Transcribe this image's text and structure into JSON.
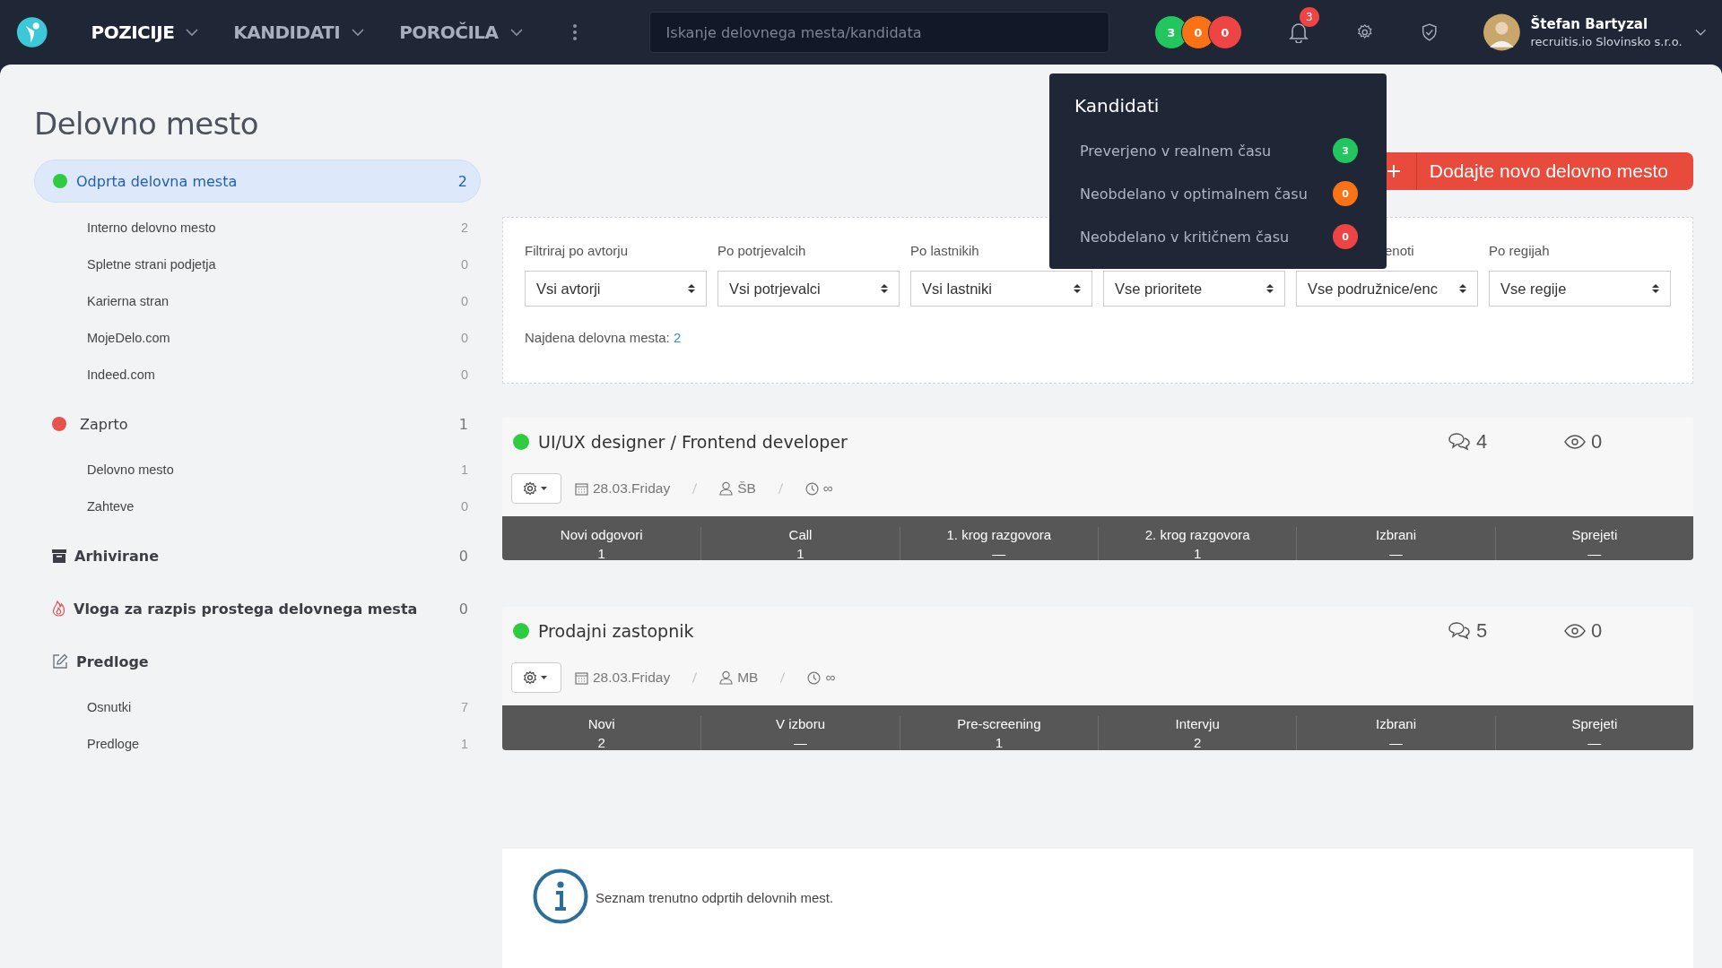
{
  "topbar": {
    "nav": [
      {
        "label": "POZICIJE",
        "selected": true
      },
      {
        "label": "KANDIDATI",
        "selected": false
      },
      {
        "label": "POROČILA",
        "selected": false
      }
    ],
    "search": {
      "placeholder": "Iskanje delovnega mesta/kandidata"
    },
    "counters": [
      {
        "value": "3",
        "color": "#22c55e"
      },
      {
        "value": "0",
        "color": "#f97316"
      },
      {
        "value": "0",
        "color": "#ef4444"
      }
    ],
    "notifications": "3",
    "user": {
      "name": "Štefan Bartyzal",
      "company": "recruitis.io Slovinsko s.r.o."
    }
  },
  "sidebar": {
    "title": "Delovno mesto",
    "groups": [
      {
        "label": "Odprta delovna mesta",
        "count": "2",
        "kind": "dot",
        "color": "#2ecc40",
        "selected": true,
        "children": [
          {
            "label": "Interno delovno mesto",
            "count": "2"
          },
          {
            "label": "Spletne strani podjetja",
            "count": "0"
          },
          {
            "label": "Karierna stran",
            "count": "0"
          },
          {
            "label": "MojeDelo.com",
            "count": "0"
          },
          {
            "label": "Indeed.com",
            "count": "0"
          }
        ]
      },
      {
        "label": "Zaprto",
        "count": "1",
        "kind": "dot",
        "color": "#e5534b",
        "selected": false,
        "children": [
          {
            "label": "Delovno mesto",
            "count": "1"
          },
          {
            "label": "Zahteve",
            "count": "0"
          }
        ]
      },
      {
        "label": "Arhivirane",
        "count": "0",
        "kind": "archive",
        "selected": false
      },
      {
        "label": "Vloga za razpis prostega delovnega mesta",
        "count": "0",
        "kind": "flame",
        "selected": false
      },
      {
        "label": "Predloge",
        "kind": "edit",
        "selected": false,
        "children": [
          {
            "label": "Osnutki",
            "count": "7"
          },
          {
            "label": "Predloge",
            "count": "1"
          }
        ]
      }
    ]
  },
  "add_button": {
    "label": "Dodajte novo delovno mesto"
  },
  "filters": {
    "fields": [
      {
        "label": "Filtriraj po avtorju",
        "value": "Vsi avtorji"
      },
      {
        "label": "Po potrjevalcih",
        "value": "Vsi potrjevalci"
      },
      {
        "label": "Po lastnikih",
        "value": "Vsi lastniki"
      },
      {
        "value": "Vse prioritete"
      },
      {
        "label": "enoti",
        "cut": true,
        "value": "Vse podružnice/enc"
      },
      {
        "label": "Po regijah",
        "value": "Vse regije"
      }
    ],
    "found_label": "Najdena delovna mesta:",
    "found_count": "2"
  },
  "popover": {
    "title": "Kandidati",
    "items": [
      {
        "label": "Preverjeno v realnem času",
        "count": "3",
        "color": "#22c55e"
      },
      {
        "label": "Neobdelano v optimalnem času",
        "count": "0",
        "color": "#f97316"
      },
      {
        "label": "Neobdelano v kritičnem času",
        "count": "0",
        "color": "#ef4444"
      }
    ]
  },
  "jobs": [
    {
      "title": "UI/UX designer / Frontend developer",
      "color": "#2ecc40",
      "comments": "4",
      "views": "0",
      "date": "28.03.Friday",
      "owner": "ŠB",
      "deadline": "∞",
      "stages": [
        {
          "name": "Novi odgovori",
          "count": "1"
        },
        {
          "name": "Call",
          "count": "1"
        },
        {
          "name": "1. krog razgovora",
          "count": "—"
        },
        {
          "name": "2. krog razgovora",
          "count": "1"
        },
        {
          "name": "Izbrani",
          "count": "—"
        },
        {
          "name": "Sprejeti",
          "count": "—"
        }
      ]
    },
    {
      "title": "Prodajni zastopnik",
      "color": "#2ecc40",
      "comments": "5",
      "views": "0",
      "date": "28.03.Friday",
      "owner": "MB",
      "deadline": "∞",
      "stages": [
        {
          "name": "Novi",
          "count": "2"
        },
        {
          "name": "V izboru",
          "count": "—"
        },
        {
          "name": "Pre-screening",
          "count": "1"
        },
        {
          "name": "Intervju",
          "count": "2"
        },
        {
          "name": "Izbrani",
          "count": "—"
        },
        {
          "name": "Sprejeti",
          "count": "—"
        }
      ]
    }
  ],
  "info": "Seznam trenutno odprtih delovnih mest."
}
